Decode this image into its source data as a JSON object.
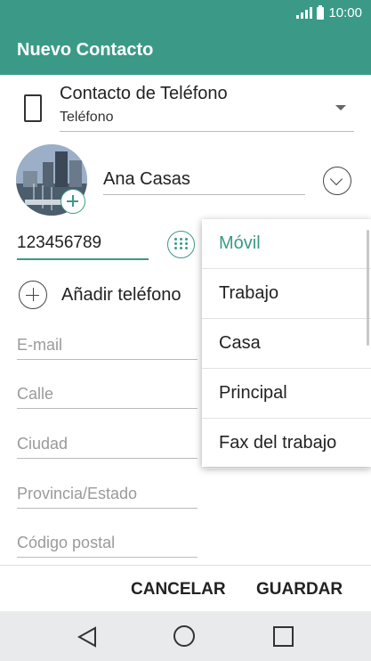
{
  "status_bar": {
    "time": "10:00",
    "icons": [
      "signal-icon",
      "battery-icon"
    ]
  },
  "app_bar": {
    "title": "Nuevo Contacto"
  },
  "account": {
    "title": "Contacto de Teléfono",
    "subtitle": "Teléfono",
    "icon": "phone-device-icon"
  },
  "contact": {
    "name": "Ana Casas",
    "phone": "123456789",
    "add_phone_label": "Añadir teléfono"
  },
  "fields": {
    "email": "E-mail",
    "street": "Calle",
    "city": "Ciudad",
    "state": "Provincia/Estado",
    "postal_code": "Código postal"
  },
  "phone_type_menu": {
    "selected": "Móvil",
    "items": [
      "Móvil",
      "Trabajo",
      "Casa",
      "Principal",
      "Fax del trabajo"
    ]
  },
  "actions": {
    "cancel": "CANCELAR",
    "save": "GUARDAR"
  },
  "colors": {
    "accent": "#3a9a87",
    "navbar": "#e9eaec"
  }
}
